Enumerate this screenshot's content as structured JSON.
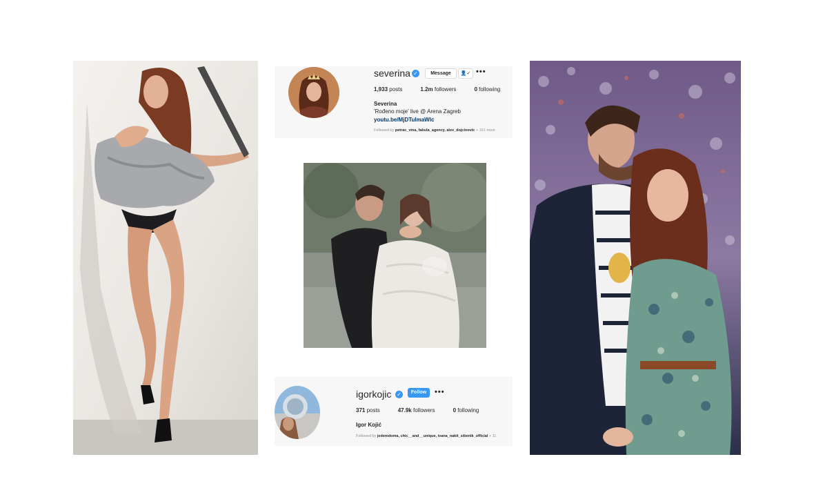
{
  "severina": {
    "username": "severina",
    "message_button": "Message",
    "follow_icon": "person-check-icon",
    "more": "•••",
    "posts_count": "1,933",
    "posts_label": "posts",
    "followers_count": "1.2m",
    "followers_label": "followers",
    "following_count": "0",
    "following_label": "following",
    "full_name": "Severina",
    "bio": "'Rođeno moje' live @ Arena Zagreb",
    "link": "youtu.be/MjDTulmaWlc",
    "followed_by_prefix": "Followed by",
    "followed_by_names": "petrac_vina, fabula_agency, alex_dojcinovic",
    "followed_by_more": "+ 161 more"
  },
  "igor": {
    "username": "igorkojic",
    "follow_button": "Follow",
    "more": "•••",
    "posts_count": "371",
    "posts_label": "posts",
    "followers_count": "47.9k",
    "followers_label": "followers",
    "following_count": "0",
    "following_label": "following",
    "full_name": "Igor Kojić",
    "followed_by_prefix": "Followed by",
    "followed_by_names": "jedemdoma, chic__and__unique, ivana_nakit_sibenik_official",
    "followed_by_more": "+ 11"
  },
  "colors": {
    "verified": "#3897f0",
    "follow_button": "#3897f0",
    "link": "#00376b",
    "card_bg": "#f7f7f7"
  }
}
